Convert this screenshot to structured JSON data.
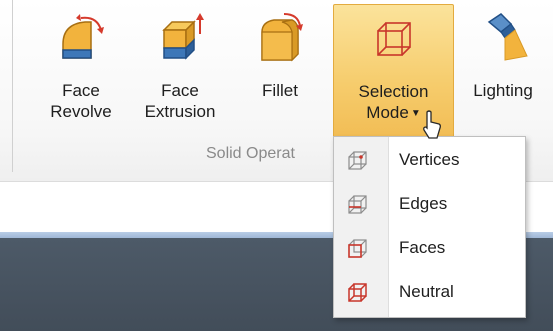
{
  "ribbon": {
    "buttons": [
      {
        "id": "face-revolve",
        "label": "Face\nRevolve",
        "icon": "face-revolve-icon"
      },
      {
        "id": "face-extrusion",
        "label": "Face\nExtrusion",
        "icon": "face-extrusion-icon"
      },
      {
        "id": "fillet",
        "label": "Fillet",
        "icon": "fillet-icon"
      },
      {
        "id": "selection-mode",
        "label": "Selection\nMode",
        "icon": "selection-mode-icon",
        "active": true,
        "has_dropdown": true
      },
      {
        "id": "lighting",
        "label": "Lighting",
        "icon": "lighting-icon"
      }
    ],
    "group_caption": "Solid Operat"
  },
  "selection_menu": {
    "items": [
      {
        "label": "Vertices",
        "icon": "vertices-icon"
      },
      {
        "label": "Edges",
        "icon": "edges-icon"
      },
      {
        "label": "Faces",
        "icon": "faces-icon"
      },
      {
        "label": "Neutral",
        "icon": "neutral-icon"
      }
    ]
  },
  "colors": {
    "active_button": "#f6cc6c",
    "icon_orange": "#f2b33d",
    "icon_blue": "#3d77b8",
    "cube_red": "#c8362b",
    "cube_gray": "#8c8c8c",
    "viewport_dark": "#4a5664"
  }
}
